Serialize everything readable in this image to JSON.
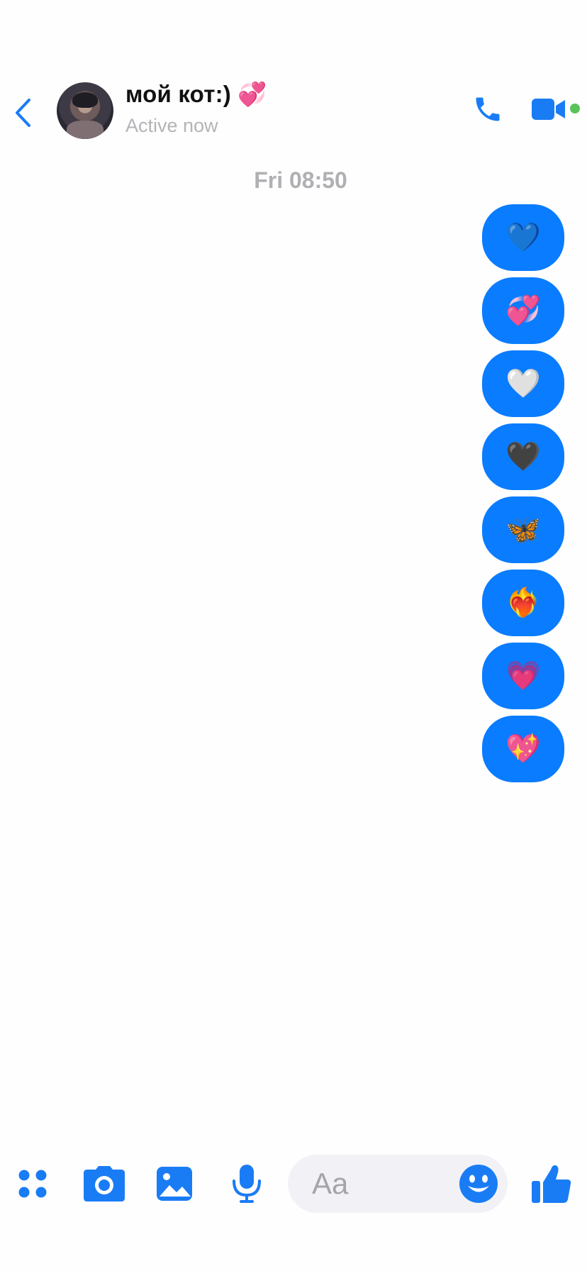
{
  "header": {
    "contact_name": "мой кот:) 💞",
    "status": "Active now"
  },
  "timestamp": "Fri 08:50",
  "messages": [
    {
      "emoji": "💙"
    },
    {
      "emoji": "💞"
    },
    {
      "emoji": "🤍"
    },
    {
      "emoji": "🖤"
    },
    {
      "emoji": "🦋"
    },
    {
      "emoji": "❤️‍🔥"
    },
    {
      "emoji": "💗"
    },
    {
      "emoji": "💖"
    }
  ],
  "composer": {
    "placeholder": "Aa"
  },
  "colors": {
    "accent": "#0a7cff",
    "icon_blue": "#1a7cf5",
    "online": "#5ac35a",
    "muted_text": "#b0b0b4"
  },
  "icons": [
    "chevron-left-icon",
    "phone-icon",
    "video-camera-icon",
    "apps-grid-icon",
    "camera-icon",
    "image-icon",
    "microphone-icon",
    "smiley-icon",
    "thumbs-up-icon"
  ]
}
